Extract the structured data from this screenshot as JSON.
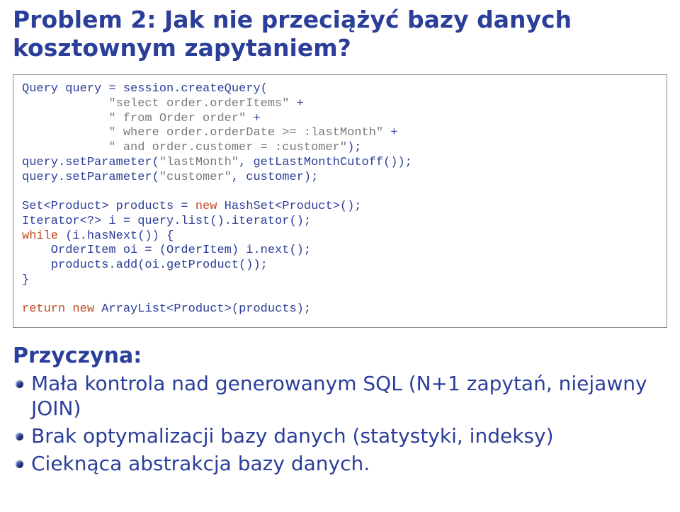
{
  "title": "Problem 2: Jak nie przeciążyć bazy danych kosztownym zapytaniem?",
  "code": {
    "l1a": "Query query = session.createQuery(",
    "l2": "            \"select order.orderItems\"",
    "l2b": " +",
    "l3": "            \" from Order order\"",
    "l3b": " +",
    "l4": "            \" where order.orderDate >= :lastMonth\"",
    "l4b": " +",
    "l5": "            \" and order.customer = :customer\"",
    "l5b": ");",
    "l6a": "query.setParameter(",
    "l6b": "\"lastMonth\"",
    "l6c": ", getLastMonthCutoff());",
    "l7a": "query.setParameter(",
    "l7b": "\"customer\"",
    "l7c": ", customer);",
    "l8a": "Set<Product> products = ",
    "l8kw": "new",
    "l8b": " HashSet<Product>();",
    "l9": "Iterator<?> i = query.list().iterator();",
    "l10kw": "while",
    "l10a": " (i.hasNext()) {",
    "l11": "    OrderItem oi = (OrderItem) i.next();",
    "l12": "    products.add(oi.getProduct());",
    "l13": "}",
    "l14kw1": "return",
    "l14sp": " ",
    "l14kw2": "new",
    "l14a": " ArrayList<Product>(products);"
  },
  "cause_heading": "Przyczyna:",
  "causes": [
    "Mała kontrola nad generowanym SQL (N+1 zapytań, niejawny JOIN)",
    "Brak optymalizacji bazy danych (statystyki, indeksy)",
    "Cieknąca abstrakcja bazy danych."
  ]
}
